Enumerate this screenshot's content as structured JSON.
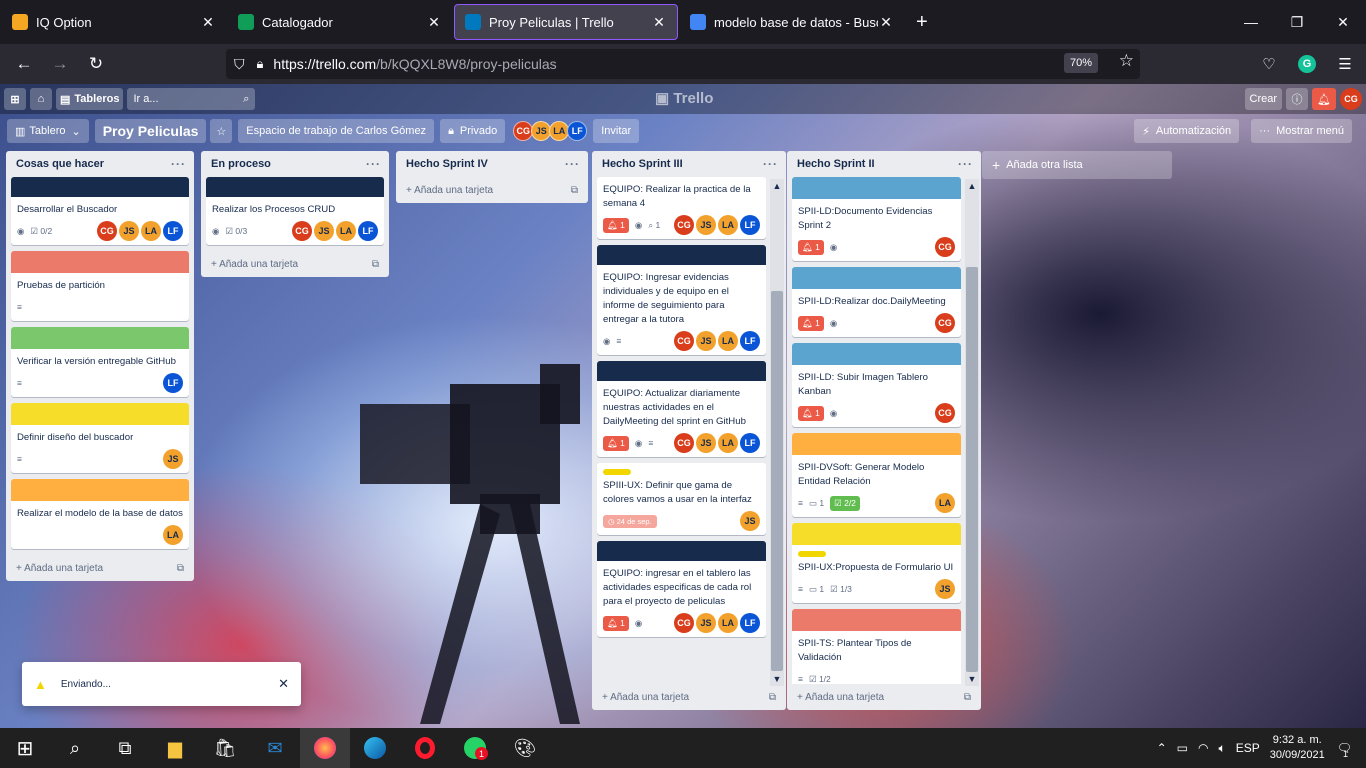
{
  "browser": {
    "tabs": [
      {
        "title": "IQ Option",
        "icon": "bar-chart-icon",
        "color": "#f5a623"
      },
      {
        "title": "Catalogador",
        "icon": "sheets-icon",
        "color": "#0f9d58"
      },
      {
        "title": "Proy Peliculas | Trello",
        "icon": "trello-icon",
        "color": "#0079bf"
      },
      {
        "title": "modelo base de datos - Buscar c",
        "icon": "google-icon",
        "color": "#4285f4"
      }
    ],
    "url_domain": "https://trello.com",
    "url_path": "/b/kQQXL8W8/proy-peliculas",
    "zoom": "70%"
  },
  "header": {
    "boards_label": "Tableros",
    "search_placeholder": "Ir a...",
    "logo": "Trello",
    "create_label": "Crear",
    "user_initials": "CG"
  },
  "boardbar": {
    "view_label": "Tablero",
    "title": "Proy Peliculas",
    "workspace": "Espacio de trabajo de Carlos Gómez",
    "visibility": "Privado",
    "members": [
      "CG",
      "JS",
      "LA",
      "LF"
    ],
    "invite_label": "Invitar",
    "automation_label": "Automatización",
    "menu_label": "Mostrar menú"
  },
  "lists": [
    {
      "title": "Cosas que hacer",
      "add_label": "Añada una tarjeta",
      "cards": [
        {
          "cover": "#172b4d",
          "title": "Desarrollar el Buscador",
          "watch": true,
          "checklist": "0/2",
          "members": [
            "CG",
            "JS",
            "LA",
            "LF"
          ]
        },
        {
          "cover": "#eb7a6b",
          "title": "Pruebas de partición",
          "desc": true,
          "members": []
        },
        {
          "cover": "#7bc86c",
          "title": "Verificar la versión entregable GitHub",
          "desc": true,
          "members": [
            "LF"
          ]
        },
        {
          "cover": "#f5dd29",
          "title": "Definir diseño del buscador",
          "desc": true,
          "members": [
            "JS"
          ]
        },
        {
          "cover": "#ffaf3f",
          "title": "Realizar el modelo de la base de datos",
          "members": [
            "LA"
          ]
        }
      ]
    },
    {
      "title": "En proceso",
      "add_label": "Añada una tarjeta",
      "cards": [
        {
          "cover": "#172b4d",
          "title": "Realizar los Procesos CRUD",
          "watch": true,
          "checklist": "0/3",
          "members": [
            "CG",
            "JS",
            "LA",
            "LF"
          ]
        }
      ]
    },
    {
      "title": "Hecho Sprint IV",
      "add_label": "Añada una tarjeta",
      "cards": []
    },
    {
      "title": "Hecho Sprint III",
      "add_label": "Añada una tarjeta",
      "cards": [
        {
          "cover": "",
          "title": "EQUIPO: Realizar la practica de la semana 4",
          "notif": "1",
          "watch": true,
          "attach": "1",
          "members": [
            "CG",
            "JS",
            "LA",
            "LF"
          ]
        },
        {
          "cover": "#172b4d",
          "title": "EQUIPO: Ingresar evidencias individuales y de equipo en el informe de seguimiento para entregar a la tutora",
          "watch": true,
          "desc": true,
          "members": [
            "CG",
            "JS",
            "LA",
            "LF"
          ]
        },
        {
          "cover": "#172b4d",
          "title": "EQUIPO: Actualizar diariamente nuestras actividades en el DailyMeeting del sprint en GitHub",
          "notif": "1",
          "watch": true,
          "desc": true,
          "members": [
            "CG",
            "JS",
            "LA",
            "LF"
          ]
        },
        {
          "cover": "",
          "label": true,
          "title": "SPIII-UX: Definir que gama de colores vamos a usar en la interfaz",
          "due": "24 de sep.",
          "members": [
            "JS"
          ]
        },
        {
          "cover": "#172b4d",
          "title": "EQUIPO: ingresar en el tablero las actividades especificas de cada rol para el proyecto de peliculas",
          "notif": "1",
          "watch": true,
          "members": [
            "CG",
            "JS",
            "LA",
            "LF"
          ]
        }
      ]
    },
    {
      "title": "Hecho Sprint II",
      "add_label": "Añada una tarjeta",
      "cards": [
        {
          "cover": "#5ba4cf",
          "title": "SPII-LD:Documento Evidencias Sprint 2",
          "notif": "1",
          "watch": true,
          "members": [
            "CG"
          ]
        },
        {
          "cover": "#5ba4cf",
          "title": "SPII-LD:Realizar doc.DailyMeeting",
          "notif": "1",
          "watch": true,
          "members": [
            "CG"
          ]
        },
        {
          "cover": "#5ba4cf",
          "title": "SPII-LD: Subir Imagen Tablero Kanban",
          "notif": "1",
          "watch": true,
          "members": [
            "CG"
          ]
        },
        {
          "cover": "#ffaf3f",
          "title": "SPII-DVSoft: Generar Modelo Entidad Relación",
          "desc": true,
          "comments": "1",
          "checklist_done": "2/2",
          "members": [
            "LA"
          ]
        },
        {
          "cover": "#f5dd29",
          "label": true,
          "title": "SPII-UX:Propuesta de Formulario UI",
          "desc": true,
          "comments": "1",
          "checklist": "1/3",
          "members": [
            "JS"
          ]
        },
        {
          "cover": "#eb7a6b",
          "title": "SPII-TS: Plantear Tipos de Validación",
          "desc": true,
          "checklist": "1/2",
          "members": []
        }
      ]
    }
  ],
  "add_list_label": "Añada otra lista",
  "toast": {
    "message": "Enviando..."
  },
  "taskbar": {
    "lang": "ESP",
    "time": "9:32 a. m.",
    "date": "30/09/2021",
    "notif_count": "1",
    "whatsapp_badge": "1"
  }
}
